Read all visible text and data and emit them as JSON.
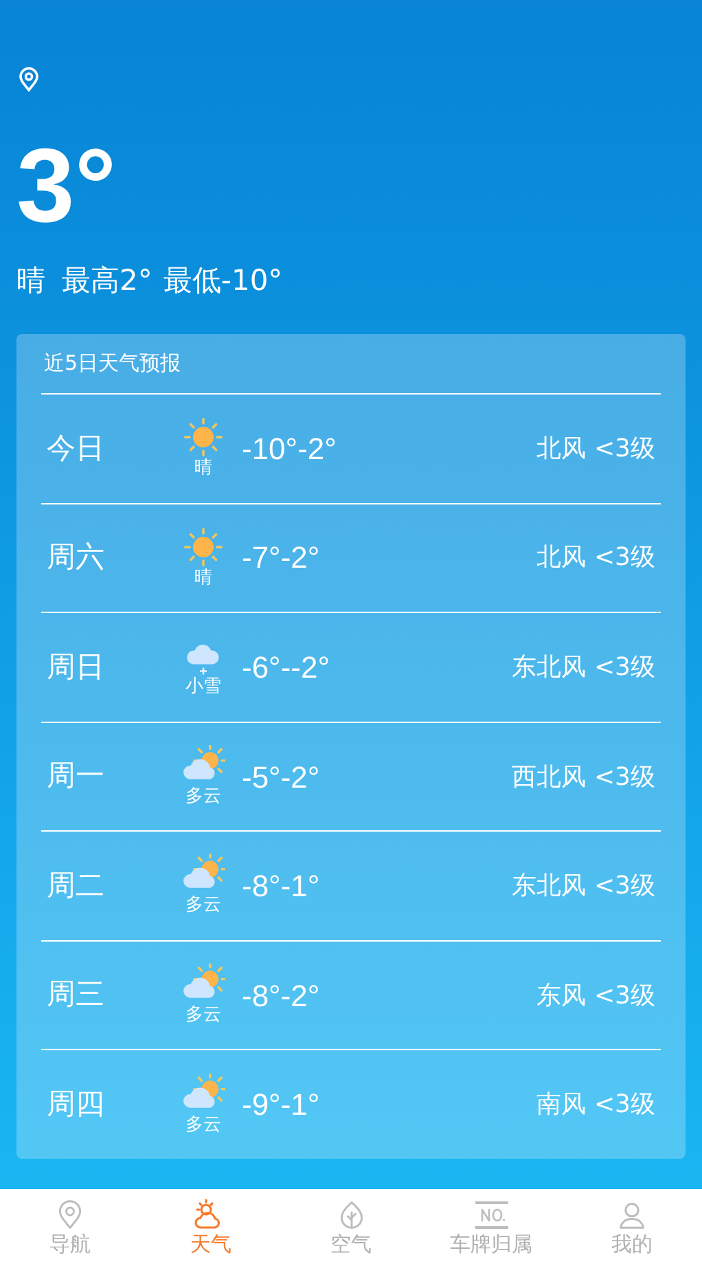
{
  "current": {
    "temperature": "3°",
    "condition": "晴",
    "high": "最高2°",
    "low": "最低-10°"
  },
  "forecast": {
    "title": "近5日天气预报",
    "days": [
      {
        "day": "今日",
        "kind": "sunny",
        "condition": "晴",
        "range": "-10°-2°",
        "wind": "北风 <3级"
      },
      {
        "day": "周六",
        "kind": "sunny",
        "condition": "晴",
        "range": "-7°-2°",
        "wind": "北风 <3级"
      },
      {
        "day": "周日",
        "kind": "snow",
        "condition": "小雪",
        "range": "-6°--2°",
        "wind": "东北风 <3级"
      },
      {
        "day": "周一",
        "kind": "cloudy",
        "condition": "多云",
        "range": "-5°-2°",
        "wind": "西北风 <3级"
      },
      {
        "day": "周二",
        "kind": "cloudy",
        "condition": "多云",
        "range": "-8°-1°",
        "wind": "东北风 <3级"
      },
      {
        "day": "周三",
        "kind": "cloudy",
        "condition": "多云",
        "range": "-8°-2°",
        "wind": "东风 <3级"
      },
      {
        "day": "周四",
        "kind": "cloudy",
        "condition": "多云",
        "range": "-9°-1°",
        "wind": "南风 <3级"
      }
    ]
  },
  "nav": [
    {
      "label": "导航",
      "kind": "pin",
      "selected": false
    },
    {
      "label": "天气",
      "kind": "weather",
      "selected": true
    },
    {
      "label": "空气",
      "kind": "leaf",
      "selected": false
    },
    {
      "label": "车牌归属",
      "kind": "plate",
      "selected": false
    },
    {
      "label": "我的",
      "kind": "person",
      "selected": false
    }
  ]
}
